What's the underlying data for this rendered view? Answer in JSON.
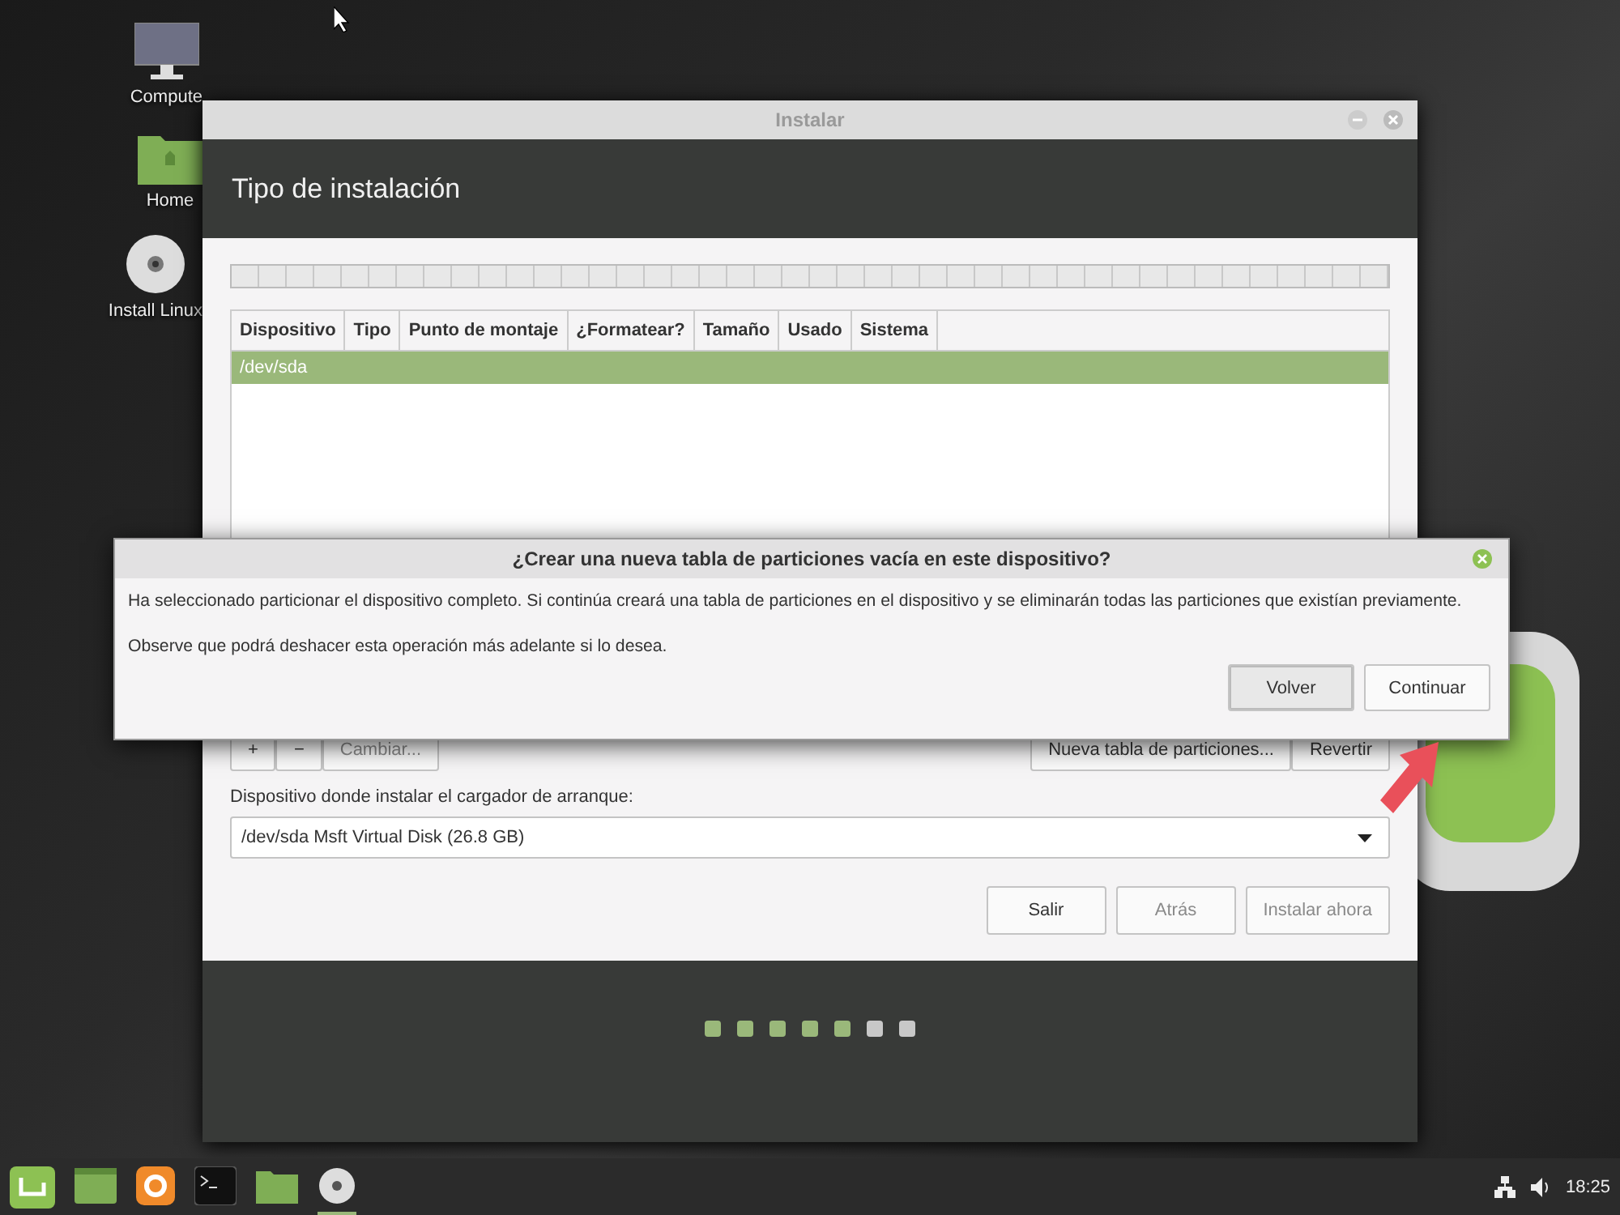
{
  "desktop_icons": [
    {
      "kind": "computer",
      "label": "Compute"
    },
    {
      "kind": "home",
      "label": "Home"
    },
    {
      "kind": "disc",
      "label": "Install Linux"
    }
  ],
  "window": {
    "title": "Instalar",
    "heading": "Tipo de instalación",
    "table": {
      "columns": [
        "Dispositivo",
        "Tipo",
        "Punto de montaje",
        "¿Formatear?",
        "Tamaño",
        "Usado",
        "Sistema"
      ],
      "rows": [
        {
          "cells": [
            "/dev/sda"
          ],
          "selected": true
        }
      ]
    },
    "partition_tools": [
      {
        "label": "+",
        "disabled": false
      },
      {
        "label": "−",
        "disabled": false
      },
      {
        "label": "Cambiar...",
        "disabled": true
      }
    ],
    "table_actions": [
      {
        "label": "Nueva tabla de particiones...",
        "disabled": false
      },
      {
        "label": "Revertir",
        "disabled": false
      }
    ],
    "bootloader_label": "Dispositivo donde instalar el cargador de arranque:",
    "bootloader_value": "/dev/sda Msft Virtual Disk (26.8 GB)",
    "buttons": [
      {
        "label": "Salir",
        "disabled": false
      },
      {
        "label": "Atrás",
        "disabled": true
      },
      {
        "label": "Instalar ahora",
        "disabled": true
      }
    ],
    "steps": [
      {
        "done": true
      },
      {
        "done": true
      },
      {
        "done": true
      },
      {
        "done": true
      },
      {
        "done": true
      },
      {
        "done": false
      },
      {
        "done": false
      }
    ]
  },
  "dialog": {
    "title": "¿Crear una nueva tabla de particiones vacía en este dispositivo?",
    "message": "Ha seleccionado particionar el dispositivo completo. Si continúa creará una tabla de particiones en el dispositivo y se eliminarán todas las particiones que existían previamente.",
    "note": "Observe que podrá deshacer esta operación más adelante si lo desea.",
    "buttons": [
      {
        "label": "Volver",
        "highlighted": true
      },
      {
        "label": "Continuar",
        "highlighted": false
      }
    ]
  },
  "taskbar": {
    "apps": [
      {
        "kind": "desktop",
        "active": false
      },
      {
        "kind": "browser",
        "active": false
      },
      {
        "kind": "terminal",
        "active": false
      },
      {
        "kind": "folder",
        "active": false
      },
      {
        "kind": "disc",
        "active": true
      }
    ],
    "time": "18:25"
  }
}
